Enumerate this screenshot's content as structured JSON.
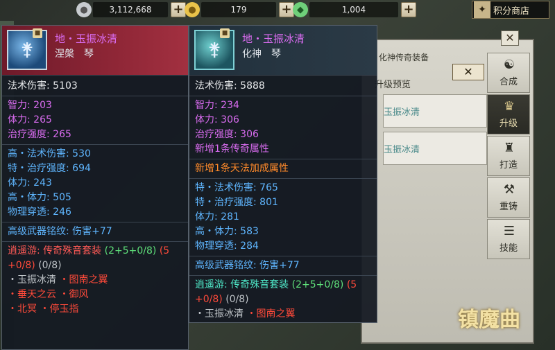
{
  "currency": {
    "silver": {
      "icon": "silver-coin-icon",
      "value": "3,112,668"
    },
    "gold": {
      "icon": "gold-coin-icon",
      "value": "179"
    },
    "jade": {
      "icon": "jade-ingot-icon",
      "value": "1,004"
    },
    "plus_label": "+",
    "shop_label": "积分商店"
  },
  "background_panel": {
    "header": "化神传奇装备",
    "subheader": "升级预览",
    "slots": [
      "玉振冰清",
      "玉振冰清"
    ],
    "close_label": "✕"
  },
  "side_tabs": [
    {
      "label": "合成",
      "icon": "swirl-icon"
    },
    {
      "label": "升级",
      "icon": "upgrade-emblem-icon",
      "active": true
    },
    {
      "label": "打造",
      "icon": "robe-icon"
    },
    {
      "label": "重铸",
      "icon": "anvil-icon"
    },
    {
      "label": "技能",
      "icon": "scroll-icon"
    }
  ],
  "logo_text": "镇魔曲",
  "left_card": {
    "name": "地・玉振冰清",
    "sub": "涅槃　琴",
    "base": "法术伤害: 5103",
    "attrs": [
      "智力: 203",
      "体力: 265",
      "治疗强度: 265"
    ],
    "extra": [
      "高・法术伤害: 530",
      "特・治疗强度: 694",
      "体力: 243",
      "高・体力: 505",
      "物理穿透: 246"
    ],
    "rune": "高级武器铭纹: 伤害+77",
    "set_name": "逍遥游: 传奇殊音套装",
    "set_count_a": "(2+5+0/8)",
    "set_count_b": "(5",
    "set_count_c": "+0/8)",
    "set_count_d": "(0/8)",
    "set_items": [
      [
        "玉振冰清",
        "图南之翼"
      ],
      [
        "垂天之云",
        "御风"
      ],
      [
        "北冥",
        "停玉指"
      ]
    ]
  },
  "right_card": {
    "name": "地・玉振冰清",
    "sub": "化神　琴",
    "base": "法术伤害: 5888",
    "attrs": [
      "智力: 234",
      "体力: 306",
      "治疗强度: 306"
    ],
    "new_legend": "新增1条传奇属性",
    "new_sky": "新增1条天法加成属性",
    "extra": [
      "特・法术伤害: 765",
      "特・治疗强度: 801",
      "体力: 281",
      "高・体力: 583",
      "物理穿透: 284"
    ],
    "rune": "高级武器铭纹: 伤害+77",
    "set_name": "逍遥游: 传奇殊音套装",
    "set_count_a": "(2+5+0/8)",
    "set_count_b": "(5",
    "set_count_c": "+0/8)",
    "set_count_d": "(0/8)",
    "set_items": [
      [
        "玉振冰清",
        "图南之翼"
      ]
    ]
  }
}
